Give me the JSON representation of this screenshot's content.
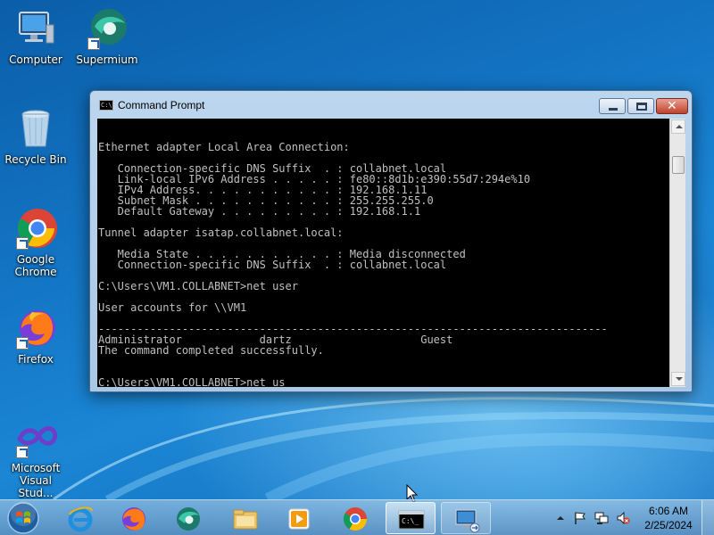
{
  "desktop": {
    "icons": [
      {
        "label": "Computer"
      },
      {
        "label": "Supermium"
      },
      {
        "label": "Recycle Bin"
      },
      {
        "label": "Google Chrome"
      },
      {
        "label": "Firefox"
      },
      {
        "label": "Microsoft Visual Stud..."
      }
    ]
  },
  "window": {
    "title": "Command Prompt",
    "console_lines": [
      "",
      "",
      "Ethernet adapter Local Area Connection:",
      "",
      "   Connection-specific DNS Suffix  . : collabnet.local",
      "   Link-local IPv6 Address . . . . . : fe80::8d1b:e390:55d7:294e%10",
      "   IPv4 Address. . . . . . . . . . . : 192.168.1.11",
      "   Subnet Mask . . . . . . . . . . . : 255.255.255.0",
      "   Default Gateway . . . . . . . . . : 192.168.1.1",
      "",
      "Tunnel adapter isatap.collabnet.local:",
      "",
      "   Media State . . . . . . . . . . . : Media disconnected",
      "   Connection-specific DNS Suffix  . : collabnet.local",
      "",
      "C:\\Users\\VM1.COLLABNET>net user",
      "",
      "User accounts for \\\\VM1",
      "",
      "-------------------------------------------------------------------------------",
      "Administrator            dartz                    Guest",
      "The command completed successfully.",
      "",
      "",
      "C:\\Users\\VM1.COLLABNET>net us"
    ]
  },
  "taskbar": {
    "items": [
      {
        "name": "internet-explorer"
      },
      {
        "name": "firefox"
      },
      {
        "name": "supermium"
      },
      {
        "name": "file-explorer"
      },
      {
        "name": "media-player"
      },
      {
        "name": "chrome"
      },
      {
        "name": "command-prompt",
        "state": "active"
      },
      {
        "name": "remote-desktop",
        "state": "open"
      }
    ],
    "clock_time": "6:06 AM",
    "clock_date": "2/25/2024"
  },
  "colors": {
    "console_bg": "#000000",
    "console_text": "#c0c0c0",
    "desktop_blue": "#1374c4"
  }
}
